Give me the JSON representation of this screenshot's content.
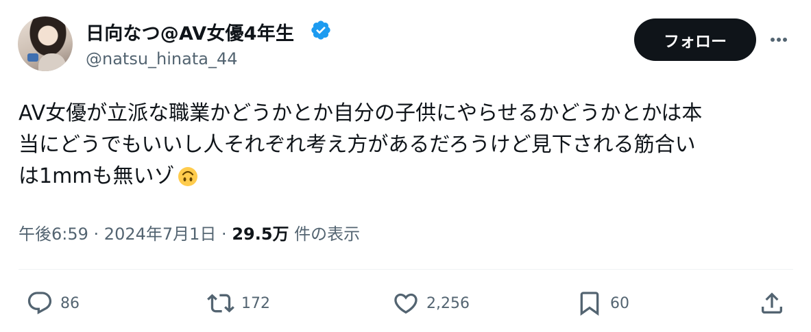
{
  "user": {
    "display_name": "日向なつ@AV女優4年生",
    "handle": "@natsu_hinata_44",
    "verified_color": "#1d9bf0"
  },
  "follow_label": "フォロー",
  "tweet": {
    "lines": [
      "AV女優が立派な職業かどうかとか自分の子供にやらせるかどうかとかは本",
      "当にどうでもいいし人それぞれ考え方があるだろうけど見下される筋合い",
      "は1mmも無いゾ"
    ],
    "emoji": "upside-down-face-emoji"
  },
  "meta": {
    "time": "午後6:59",
    "sep1": " · ",
    "date": "2024年7月1日",
    "sep2": " · ",
    "views_count": "29.5万",
    "views_label": " 件の表示"
  },
  "actions": {
    "replies": "86",
    "reposts": "172",
    "likes": "2,256",
    "bookmarks": "60"
  },
  "colors": {
    "text": "#0f1419",
    "secondary": "#536471",
    "follow_bg": "#0f1419",
    "divider": "#eff3f4"
  }
}
